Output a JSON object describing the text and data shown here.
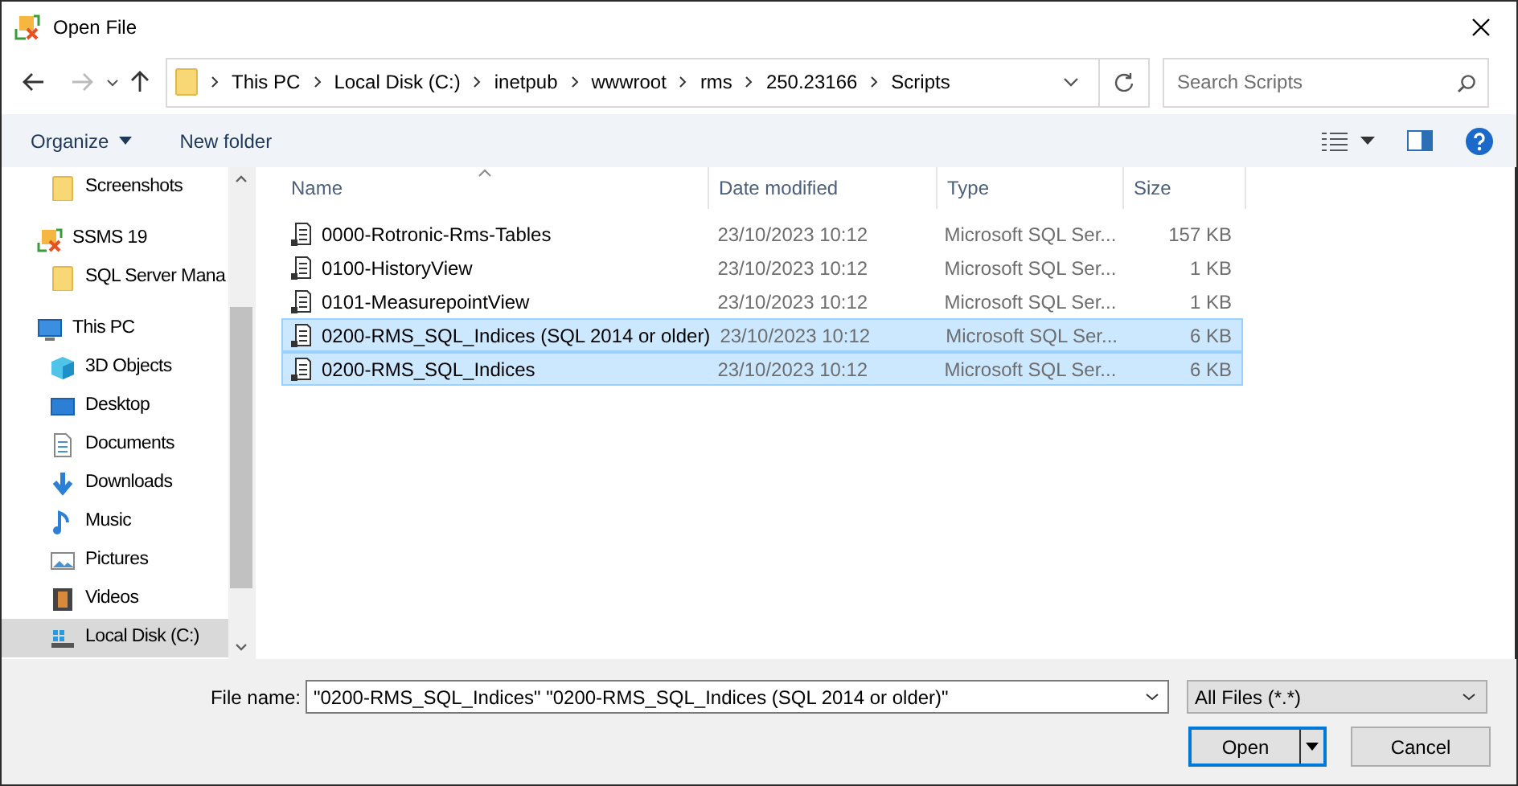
{
  "window": {
    "title": "Open File"
  },
  "address": {
    "segments": [
      "This PC",
      "Local Disk (C:)",
      "inetpub",
      "wwwroot",
      "rms",
      "250.23166",
      "Scripts"
    ]
  },
  "search": {
    "placeholder": "Search Scripts"
  },
  "toolbar": {
    "organize": "Organize",
    "new_folder": "New folder"
  },
  "sidebar": {
    "continued_items": [
      {
        "label": "Screenshots",
        "kind": "folder",
        "selected": false
      }
    ],
    "items": [
      {
        "label": "SSMS 19",
        "kind": "app",
        "selected": false,
        "children": [
          {
            "label": "SQL Server Mana",
            "kind": "folder",
            "selected": false
          }
        ]
      },
      {
        "label": "This PC",
        "kind": "pc",
        "selected": false,
        "children": [
          {
            "label": "3D Objects",
            "kind": "cube",
            "selected": false
          },
          {
            "label": "Desktop",
            "kind": "desktop",
            "selected": false
          },
          {
            "label": "Documents",
            "kind": "documents",
            "selected": false
          },
          {
            "label": "Downloads",
            "kind": "downloads",
            "selected": false
          },
          {
            "label": "Music",
            "kind": "music",
            "selected": false
          },
          {
            "label": "Pictures",
            "kind": "pictures",
            "selected": false
          },
          {
            "label": "Videos",
            "kind": "videos",
            "selected": false
          },
          {
            "label": "Local Disk (C:)",
            "kind": "drive",
            "selected": true
          }
        ]
      }
    ]
  },
  "table": {
    "columns": [
      "Name",
      "Date modified",
      "Type",
      "Size"
    ],
    "rows": [
      {
        "name": "0000-Rotronic-Rms-Tables",
        "date": "23/10/2023 10:12",
        "type": "Microsoft SQL Ser...",
        "size": "157 KB",
        "selected": false
      },
      {
        "name": "0100-HistoryView",
        "date": "23/10/2023 10:12",
        "type": "Microsoft SQL Ser...",
        "size": "1 KB",
        "selected": false
      },
      {
        "name": "0101-MeasurepointView",
        "date": "23/10/2023 10:12",
        "type": "Microsoft SQL Ser...",
        "size": "1 KB",
        "selected": false
      },
      {
        "name": "0200-RMS_SQL_Indices (SQL 2014 or older)",
        "date": "23/10/2023 10:12",
        "type": "Microsoft SQL Ser...",
        "size": "6 KB",
        "selected": true
      },
      {
        "name": "0200-RMS_SQL_Indices",
        "date": "23/10/2023 10:12",
        "type": "Microsoft SQL Ser...",
        "size": "6 KB",
        "selected": true
      }
    ]
  },
  "footer": {
    "file_name_label": "File name:",
    "file_name": "\"0200-RMS_SQL_Indices\" \"0200-RMS_SQL_Indices (SQL 2014 or older)\"",
    "filter": "All Files (*.*)",
    "open": "Open",
    "cancel": "Cancel"
  }
}
